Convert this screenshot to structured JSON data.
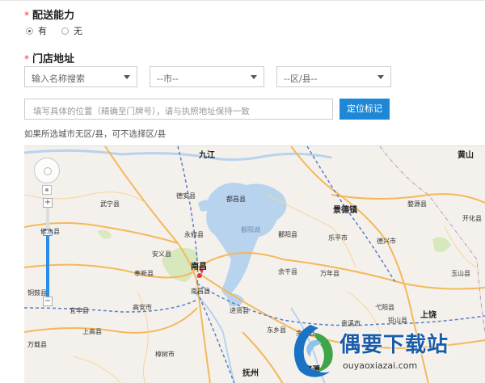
{
  "delivery": {
    "required_mark": "*",
    "title": "配送能力",
    "options": [
      {
        "label": "有",
        "selected": true
      },
      {
        "label": "无",
        "selected": false
      }
    ]
  },
  "address": {
    "required_mark": "*",
    "title": "门店地址",
    "search_select": "输入名称搜索",
    "city_select": "--市--",
    "district_select": "--区/县--",
    "detail_placeholder": "填写具体的位置（精确至门牌号），请与执照地址保持一致",
    "locate_button": "定位标记",
    "hint": "如果所选城市无区/县，可不选择区/县"
  },
  "map": {
    "zoom_level_fraction": 0.72,
    "colors": {
      "water": "#b7d3ee",
      "land": "#f4f1ec",
      "road": "#f4b85a",
      "rail": "#5b7fc2",
      "green": "#cfe6b0"
    },
    "labels": {
      "jiujiang": "九江",
      "huangshan": "黄山",
      "wuning": "武宁县",
      "dean": "德安县",
      "duchang": "都昌县",
      "poyang_lake": "鄱阳湖",
      "jingdezhen": "景德镇",
      "wuyuan": "婺源县",
      "kaihua": "开化县",
      "xiushui": "修水县",
      "yongxiu": "永修县",
      "poyang": "鄱阳县",
      "leping": "乐平市",
      "dexing": "德兴市",
      "anyi": "安义县",
      "fengxin": "奉新县",
      "nanchang": "南昌",
      "nanchang_county": "南昌县",
      "yugan": "余干县",
      "wannian": "万年县",
      "yushan": "玉山县",
      "tonggu": "铜鼓县",
      "shangrao": "上饶",
      "yiyang": "弋阳县",
      "qianshan": "铅山县",
      "yifeng": "宜丰县",
      "gaoan": "高安市",
      "jinxian": "进贤县",
      "dongxiang": "东乡县",
      "guixi": "贵溪市",
      "shanggao": "上高县",
      "wanzai": "万载县",
      "zhangshu": "樟树市",
      "fuzhou": "抚州",
      "yujiang": "余江县",
      "yingtan": "鹰潭"
    }
  },
  "watermark": {
    "title": "偶要下载站",
    "url": "ouyaoxiazai.com"
  }
}
